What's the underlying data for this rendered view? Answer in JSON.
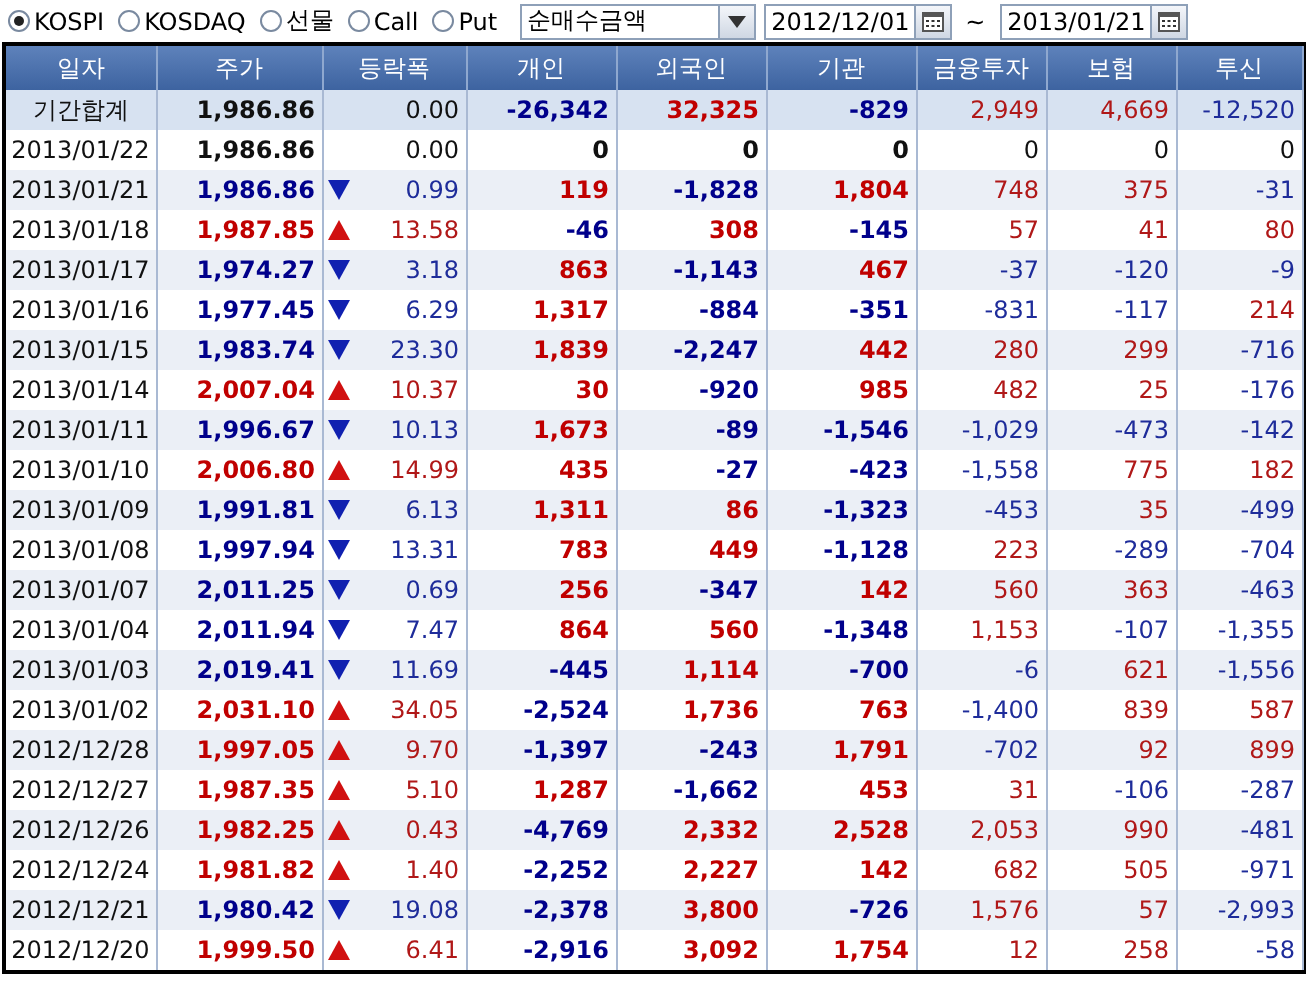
{
  "filters": {
    "markets": [
      {
        "label": "KOSPI",
        "selected": true
      },
      {
        "label": "KOSDAQ",
        "selected": false
      },
      {
        "label": "선물",
        "selected": false
      },
      {
        "label": "Call",
        "selected": false
      },
      {
        "label": "Put",
        "selected": false
      }
    ],
    "measure": {
      "value": "순매수금액"
    },
    "date_from": {
      "value": "2012/12/01"
    },
    "range_separator": "~",
    "date_to": {
      "value": "2013/01/21"
    }
  },
  "table": {
    "columns": [
      "일자",
      "주가",
      "등락폭",
      "개인",
      "외국인",
      "기관",
      "금융투자",
      "보험",
      "투신"
    ],
    "summary": {
      "date": "기간합계",
      "price": "1,986.86",
      "change": "0.00",
      "values": [
        "-26,342",
        "32,325",
        "-829",
        "2,949",
        "4,669",
        "-12,520"
      ]
    },
    "rows": [
      {
        "date": "2013/01/22",
        "price": "1,986.86",
        "kind": "flat",
        "change": "0.00",
        "values": [
          "0",
          "0",
          "0",
          "0",
          "0",
          "0"
        ]
      },
      {
        "date": "2013/01/21",
        "price": "1,986.86",
        "kind": "down",
        "change": "0.99",
        "values": [
          "119",
          "-1,828",
          "1,804",
          "748",
          "375",
          "-31"
        ]
      },
      {
        "date": "2013/01/18",
        "price": "1,987.85",
        "kind": "up",
        "change": "13.58",
        "values": [
          "-46",
          "308",
          "-145",
          "57",
          "41",
          "80"
        ]
      },
      {
        "date": "2013/01/17",
        "price": "1,974.27",
        "kind": "down",
        "change": "3.18",
        "values": [
          "863",
          "-1,143",
          "467",
          "-37",
          "-120",
          "-9"
        ]
      },
      {
        "date": "2013/01/16",
        "price": "1,977.45",
        "kind": "down",
        "change": "6.29",
        "values": [
          "1,317",
          "-884",
          "-351",
          "-831",
          "-117",
          "214"
        ]
      },
      {
        "date": "2013/01/15",
        "price": "1,983.74",
        "kind": "down",
        "change": "23.30",
        "values": [
          "1,839",
          "-2,247",
          "442",
          "280",
          "299",
          "-716"
        ]
      },
      {
        "date": "2013/01/14",
        "price": "2,007.04",
        "kind": "up",
        "change": "10.37",
        "values": [
          "30",
          "-920",
          "985",
          "482",
          "25",
          "-176"
        ]
      },
      {
        "date": "2013/01/11",
        "price": "1,996.67",
        "kind": "down",
        "change": "10.13",
        "values": [
          "1,673",
          "-89",
          "-1,546",
          "-1,029",
          "-473",
          "-142"
        ]
      },
      {
        "date": "2013/01/10",
        "price": "2,006.80",
        "kind": "up",
        "change": "14.99",
        "values": [
          "435",
          "-27",
          "-423",
          "-1,558",
          "775",
          "182"
        ]
      },
      {
        "date": "2013/01/09",
        "price": "1,991.81",
        "kind": "down",
        "change": "6.13",
        "values": [
          "1,311",
          "86",
          "-1,323",
          "-453",
          "35",
          "-499"
        ]
      },
      {
        "date": "2013/01/08",
        "price": "1,997.94",
        "kind": "down",
        "change": "13.31",
        "values": [
          "783",
          "449",
          "-1,128",
          "223",
          "-289",
          "-704"
        ]
      },
      {
        "date": "2013/01/07",
        "price": "2,011.25",
        "kind": "down",
        "change": "0.69",
        "values": [
          "256",
          "-347",
          "142",
          "560",
          "363",
          "-463"
        ]
      },
      {
        "date": "2013/01/04",
        "price": "2,011.94",
        "kind": "down",
        "change": "7.47",
        "values": [
          "864",
          "560",
          "-1,348",
          "1,153",
          "-107",
          "-1,355"
        ]
      },
      {
        "date": "2013/01/03",
        "price": "2,019.41",
        "kind": "down",
        "change": "11.69",
        "values": [
          "-445",
          "1,114",
          "-700",
          "-6",
          "621",
          "-1,556"
        ]
      },
      {
        "date": "2013/01/02",
        "price": "2,031.10",
        "kind": "up",
        "change": "34.05",
        "values": [
          "-2,524",
          "1,736",
          "763",
          "-1,400",
          "839",
          "587"
        ]
      },
      {
        "date": "2012/12/28",
        "price": "1,997.05",
        "kind": "up",
        "change": "9.70",
        "values": [
          "-1,397",
          "-243",
          "1,791",
          "-702",
          "92",
          "899"
        ]
      },
      {
        "date": "2012/12/27",
        "price": "1,987.35",
        "kind": "up",
        "change": "5.10",
        "values": [
          "1,287",
          "-1,662",
          "453",
          "31",
          "-106",
          "-287"
        ]
      },
      {
        "date": "2012/12/26",
        "price": "1,982.25",
        "kind": "up",
        "change": "0.43",
        "values": [
          "-4,769",
          "2,332",
          "2,528",
          "2,053",
          "990",
          "-481"
        ]
      },
      {
        "date": "2012/12/24",
        "price": "1,981.82",
        "kind": "up",
        "change": "1.40",
        "values": [
          "-2,252",
          "2,227",
          "142",
          "682",
          "505",
          "-971"
        ]
      },
      {
        "date": "2012/12/21",
        "price": "1,980.42",
        "kind": "down",
        "change": "19.08",
        "values": [
          "-2,378",
          "3,800",
          "-726",
          "1,576",
          "57",
          "-2,993"
        ]
      },
      {
        "date": "2012/12/20",
        "price": "1,999.50",
        "kind": "up",
        "change": "6.41",
        "values": [
          "-2,916",
          "3,092",
          "1,754",
          "12",
          "258",
          "-58"
        ]
      }
    ]
  }
}
